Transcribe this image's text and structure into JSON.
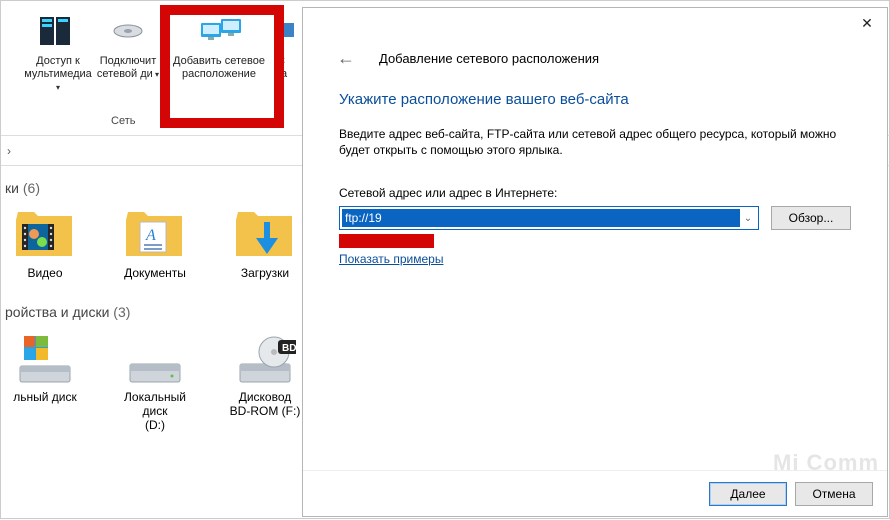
{
  "ribbon": {
    "group_label": "Сеть",
    "items": [
      {
        "label": "Доступ к\nмультимедиа",
        "icon": "media-icon",
        "has_dropdown": true
      },
      {
        "label": "Подключит\nсетевой ди",
        "icon": "network-drive-icon",
        "has_dropdown": true
      },
      {
        "label": "Добавить сетевое\nрасположение",
        "icon": "add-network-location-icon",
        "has_dropdown": false
      },
      {
        "label": "С\nпа",
        "icon": "control-panel-icon",
        "has_dropdown": false
      }
    ]
  },
  "breadcrumb_chevron": "›",
  "sections": {
    "folders": {
      "title_suffix": "ки",
      "count": "6",
      "items": [
        {
          "label": "Видео",
          "icon": "folder-video-icon"
        },
        {
          "label": "Документы",
          "icon": "folder-documents-icon"
        },
        {
          "label": "Загрузки",
          "icon": "folder-downloads-icon"
        }
      ]
    },
    "drives": {
      "title": "ройства и диски",
      "count": "3",
      "items": [
        {
          "label": "льный диск",
          "icon": "drive-windows-icon"
        },
        {
          "label": "Локальный диск\n(D:)",
          "icon": "drive-hdd-icon"
        },
        {
          "label": "Дисковод\nBD-ROM (F:)",
          "icon": "drive-bd-icon"
        }
      ]
    }
  },
  "dialog": {
    "wizard_title": "Добавление сетевого расположения",
    "heading": "Укажите расположение вашего веб-сайта",
    "description": "Введите адрес веб-сайта, FTP-сайта или сетевой адрес общего ресурса, который можно будет открыть с помощью этого ярлыка.",
    "address_label": "Сетевой адрес или адрес в Интернете:",
    "address_value": "ftp://19",
    "browse_label": "Обзор...",
    "examples_link": "Показать примеры",
    "next_label": "Далее",
    "cancel_label": "Отмена"
  },
  "watermark": "Mi Comm"
}
